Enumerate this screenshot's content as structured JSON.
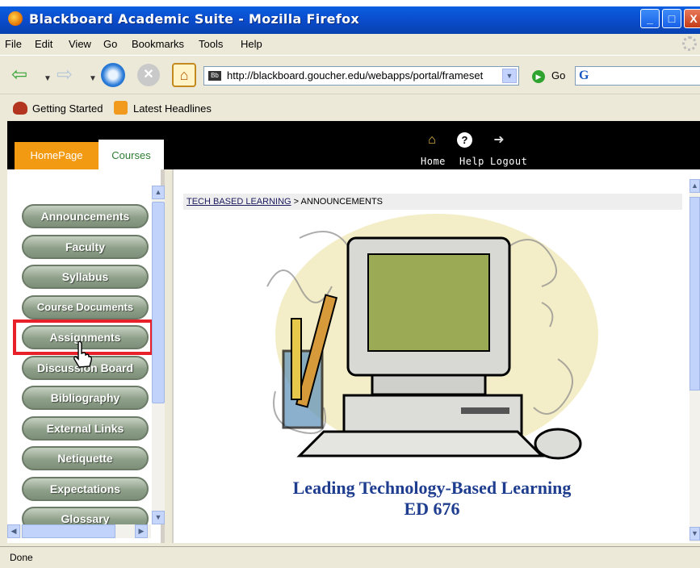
{
  "window": {
    "title": "Blackboard Academic Suite - Mozilla Firefox",
    "minimize": "_",
    "maximize": "□",
    "close": "X"
  },
  "menubar": {
    "items": [
      "File",
      "Edit",
      "View",
      "Go",
      "Bookmarks",
      "Tools",
      "Help"
    ]
  },
  "navbar": {
    "url": "http://blackboard.goucher.edu/webapps/portal/frameset",
    "go_label": "Go",
    "search_logo": "G"
  },
  "bookmarks": {
    "items": [
      "Getting Started",
      "Latest Headlines"
    ]
  },
  "header": {
    "tabs": [
      "HomePage",
      "Courses"
    ],
    "icons": [
      {
        "name": "home-icon",
        "label": "Home"
      },
      {
        "name": "help-icon",
        "label": "Help"
      },
      {
        "name": "logout-icon",
        "label": "Logout"
      }
    ]
  },
  "sidebar": {
    "items": [
      "Announcements",
      "Faculty",
      "Syllabus",
      "Course Documents",
      "Assignments",
      "Discussion Board",
      "Bibliography",
      "External Links",
      "Netiquette",
      "Expectations",
      "Glossary"
    ]
  },
  "breadcrumb": {
    "course": "TECH BASED LEARNING",
    "separator": ">",
    "current": "ANNOUNCEMENTS"
  },
  "main": {
    "caption_line1": "Leading Technology-Based Learning",
    "caption_line2": "ED 676"
  },
  "status": {
    "text": "Done"
  },
  "colors": {
    "homepage_tab": "#f39a13",
    "courses_tab_text": "#2e7d32",
    "caption": "#1e3d8f",
    "highlight": "#e8202a"
  }
}
